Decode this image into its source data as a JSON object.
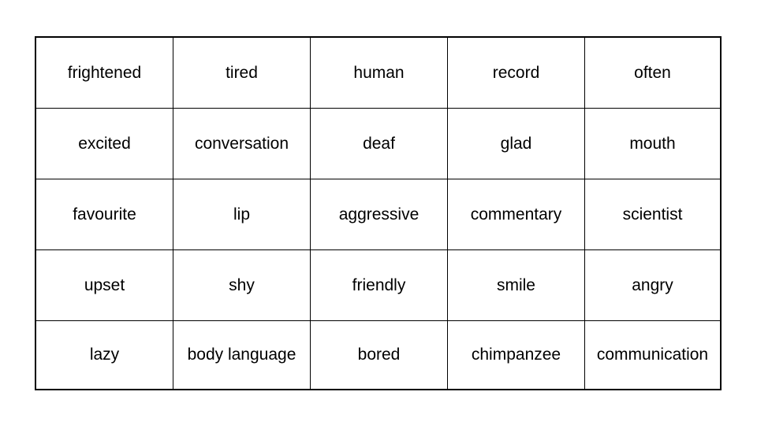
{
  "table": {
    "rows": [
      [
        "frightened",
        "tired",
        "human",
        "record",
        "often"
      ],
      [
        "excited",
        "conversation",
        "deaf",
        "glad",
        "mouth"
      ],
      [
        "favourite",
        "lip",
        "aggressive",
        "commentary",
        "scientist"
      ],
      [
        "upset",
        "shy",
        "friendly",
        "smile",
        "angry"
      ],
      [
        "lazy",
        "body language",
        "bored",
        "chimpanzee",
        "communication"
      ]
    ]
  }
}
